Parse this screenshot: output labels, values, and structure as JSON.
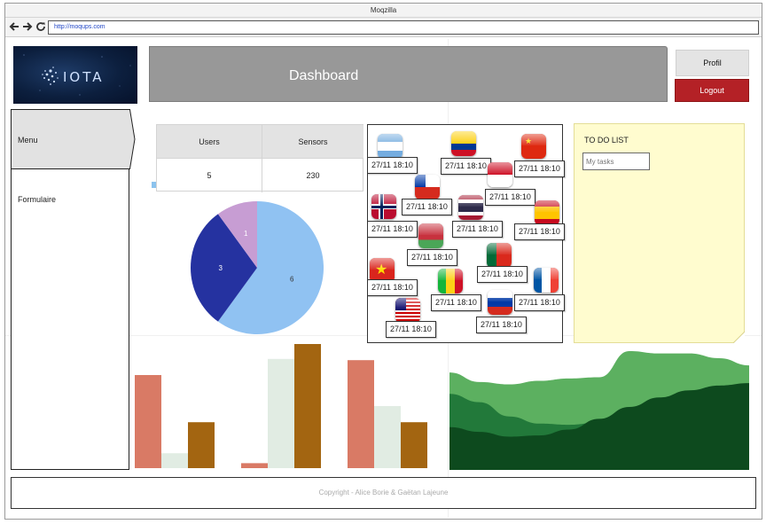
{
  "browser": {
    "title": "Moqzilla",
    "url": "http://moqups.com",
    "nav_icons": [
      "back-arrow-icon",
      "forward-arrow-icon",
      "reload-icon"
    ]
  },
  "header": {
    "logo_text": "IOTA",
    "title": "Dashboard",
    "profil_label": "Profil",
    "logout_label": "Logout",
    "colors": {
      "hero": "#989898",
      "logout": "#b42126"
    }
  },
  "sidebar": {
    "menu_label": "Menu",
    "items": [
      {
        "label": "Formulaire"
      }
    ]
  },
  "stats": {
    "columns": [
      {
        "header": "Users",
        "value": "5"
      },
      {
        "header": "Sensors",
        "value": "230"
      }
    ]
  },
  "pie_chart": {
    "type": "pie",
    "slices": [
      {
        "label": "6",
        "value": 6,
        "color": "#90c2f2"
      },
      {
        "label": "3",
        "value": 3,
        "color": "#2532a0"
      },
      {
        "label": "1",
        "value": 1,
        "color": "#c79dd3"
      }
    ]
  },
  "sensor_map": {
    "entries": [
      {
        "flag": "argentina-flag-icon",
        "time": "27/11 18:10"
      },
      {
        "flag": "colombia-flag-icon",
        "time": "27/11 18:10"
      },
      {
        "flag": "china-flag-icon",
        "time": "27/11 18:10"
      },
      {
        "flag": "chile-flag-icon",
        "time": "27/11 18:10"
      },
      {
        "flag": "indonesia-flag-icon",
        "time": "27/11 18:10"
      },
      {
        "flag": "norway-flag-icon",
        "time": "27/11 18:10"
      },
      {
        "flag": "thailand-flag-icon",
        "time": "27/11 18:10"
      },
      {
        "flag": "spain-flag-icon",
        "time": "27/11 18:10"
      },
      {
        "flag": "belarus-flag-icon",
        "time": "27/11 18:10"
      },
      {
        "flag": "portugal-flag-icon",
        "time": "27/11 18:10"
      },
      {
        "flag": "vietnam-flag-icon",
        "time": "27/11 18:10"
      },
      {
        "flag": "mali-flag-icon",
        "time": "27/11 18:10"
      },
      {
        "flag": "france-flag-icon",
        "time": "27/11 18:10"
      },
      {
        "flag": "russia-flag-icon",
        "time": "27/11 18:10"
      },
      {
        "flag": "malaysia-flag-icon",
        "time": "27/11 18:10"
      }
    ]
  },
  "todo": {
    "title": "TO DO LIST",
    "input_placeholder": "My tasks"
  },
  "chart_data": [
    {
      "type": "bar",
      "categories": [
        "",
        "",
        ""
      ],
      "ylim": [
        0,
        100
      ],
      "series": [
        {
          "values": [
            75,
            4,
            87
          ],
          "color": "#d97a65"
        },
        {
          "values": [
            12,
            88,
            50
          ],
          "color": "#e1ece3"
        },
        {
          "values": [
            37,
            100,
            37
          ],
          "color": "#a36511"
        }
      ]
    },
    {
      "type": "area",
      "x": [
        0,
        1,
        2,
        3,
        4,
        5,
        6,
        7,
        8,
        9,
        10
      ],
      "ylim": [
        0,
        100
      ],
      "series": [
        {
          "values": [
            36,
            32,
            28,
            29,
            34,
            43,
            53,
            61,
            67,
            71,
            73
          ],
          "color": "#0d4a1e"
        },
        {
          "values": [
            64,
            57,
            45,
            39,
            38,
            40,
            44,
            51,
            58,
            66,
            68
          ],
          "color": "#22793a"
        },
        {
          "values": [
            82,
            74,
            72,
            75,
            77,
            78,
            100,
            98,
            98,
            94,
            88
          ],
          "color": "#5cb060"
        }
      ]
    }
  ],
  "footer": {
    "copyright": "Copyright - Alice Borie & Gaëtan Lajeune"
  }
}
